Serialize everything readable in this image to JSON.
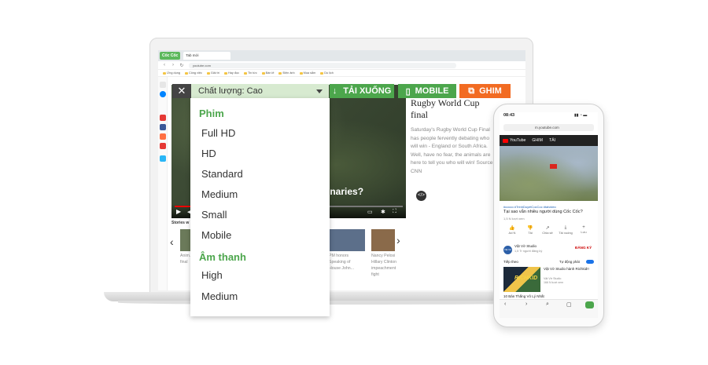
{
  "browser": {
    "brand": "Cốc Cốc",
    "tab_title": "Tab mới",
    "url": "youtube.com",
    "bookmarks": [
      "Ứng dụng",
      "Công việc",
      "Giải trí",
      "Hay đọc",
      "Tin tức",
      "Bán lẻ",
      "Điện ảnh",
      "Mua sắm",
      "Du lịch"
    ]
  },
  "toolbar": {
    "download_label": "TẢI XUỐNG",
    "mobile_label": "MOBILE",
    "pin_label": "GHIM"
  },
  "dropdown": {
    "close_label": "✕",
    "quality_label": "Chất lượng: Cao",
    "group_video": "Phim",
    "video_items": [
      "Full HD",
      "HD",
      "Standard",
      "Medium",
      "Small",
      "Mobile"
    ],
    "group_audio": "Âm thanh",
    "audio_items": [
      "High",
      "Medium"
    ]
  },
  "video": {
    "caption": "sionaries?",
    "progress_fraction": 0.3
  },
  "article": {
    "title": "Rugby World Cup final",
    "body": "Saturday's Rugby World Cup Final has people fervently debating who will win - England or South Africa. Well, have no fear, the animals are here to tell you who will win! Source: CNN"
  },
  "stories": {
    "label": "Stories w",
    "items": [
      {
        "text": "Anim... Rugby final"
      },
      {
        "text": "PM honors Speaking of House John..."
      },
      {
        "text": "Nancy Pelosi Hillary Clinton impeachment fight"
      }
    ]
  },
  "phone": {
    "time": "08:43",
    "status_right": "▮▮ ◔ ▬",
    "url": "m.youtube.com",
    "yt_label": "YouTube",
    "btn_pin": "GHIM",
    "btn_download": "TẢI",
    "tags": "#cocco #TrinhDuyetCocCoc #taivideo",
    "title": "Tại sao vẫn nhiều người dùng Cốc Cốc?",
    "meta": "1,5 N lượt xem",
    "actions": [
      {
        "icon": "👍",
        "label": "Ad N"
      },
      {
        "icon": "👎",
        "label": "Tải"
      },
      {
        "icon": "↗",
        "label": "Chia sẻ"
      },
      {
        "icon": "⤓",
        "label": "Tải xuống"
      },
      {
        "icon": "+",
        "label": "Lưu"
      }
    ],
    "channel_avatar": "Vật Vờ",
    "channel": "Vật Vờ Studio",
    "channel_sub": "1,5 Tr người đăng ký",
    "subscribe": "ĐĂNG KÝ",
    "next_label": "Tiếp theo",
    "autoplay_label": "Tự động phát",
    "related_title": "Vật Vờ Studio hành Richkid!!",
    "related_sub": "Vật Vờ Studio\n166 N lượt xem",
    "thumb_text": "RICHKID",
    "related2": "10 Bản Thắng Vô Lý Nhất"
  }
}
